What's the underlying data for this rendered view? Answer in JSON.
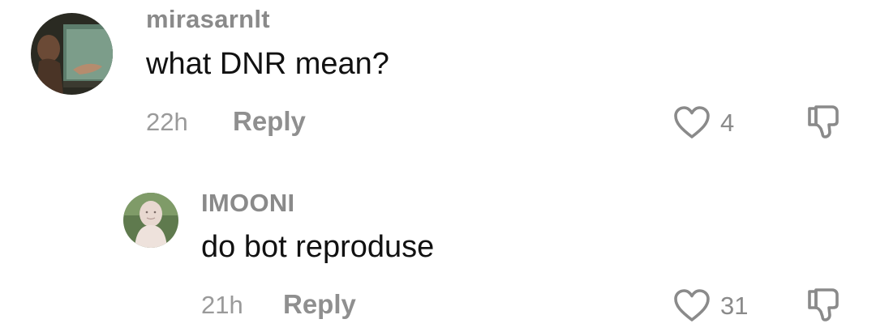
{
  "comments": [
    {
      "username": "mirasarnlt",
      "text": "what DNR mean?",
      "time": "22h",
      "reply_label": "Reply",
      "likes": "4",
      "avatar_icon": "profile-photo",
      "like_icon": "heart-outline-icon",
      "dislike_icon": "thumbs-down-outline-icon"
    },
    {
      "username": "IMOONI",
      "text": "do bot reproduse",
      "time": "21h",
      "reply_label": "Reply",
      "likes": "31",
      "avatar_icon": "profile-photo",
      "like_icon": "heart-outline-icon",
      "dislike_icon": "thumbs-down-outline-icon"
    }
  ],
  "colors": {
    "username": "#8a8a8a",
    "text": "#111111",
    "meta": "#9a9a9a",
    "icon": "#8a8a8a"
  }
}
